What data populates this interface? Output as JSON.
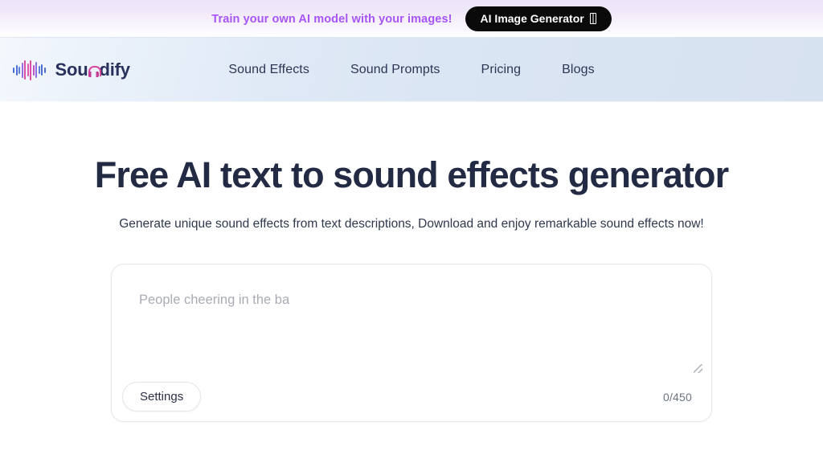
{
  "promo_banner": {
    "text": "Train your own AI model with your images!",
    "button_label": "AI Image Generator",
    "button_icon": "image-placeholder-icon",
    "text_color": "#a855f7",
    "button_bg": "#0a0a0a"
  },
  "header": {
    "brand": {
      "name_before": "Sou",
      "name_after": "dify",
      "full_name": "Soundify",
      "logo_icon": "audio-waveform-icon",
      "accent_color": "#d6499f",
      "text_color": "#27315b"
    },
    "nav": [
      {
        "label": "Sound Effects"
      },
      {
        "label": "Sound Prompts"
      },
      {
        "label": "Pricing"
      },
      {
        "label": "Blogs"
      }
    ]
  },
  "hero": {
    "title": "Free AI text to sound effects generator",
    "subtitle": "Generate unique sound effects from text descriptions, Download and enjoy remarkable sound effects now!"
  },
  "prompt_card": {
    "textarea_value": "",
    "textarea_placeholder": "People cheering in the ba",
    "resize_handle": "resize-grip-icon",
    "settings_label": "Settings",
    "char_counter": "0/450"
  }
}
